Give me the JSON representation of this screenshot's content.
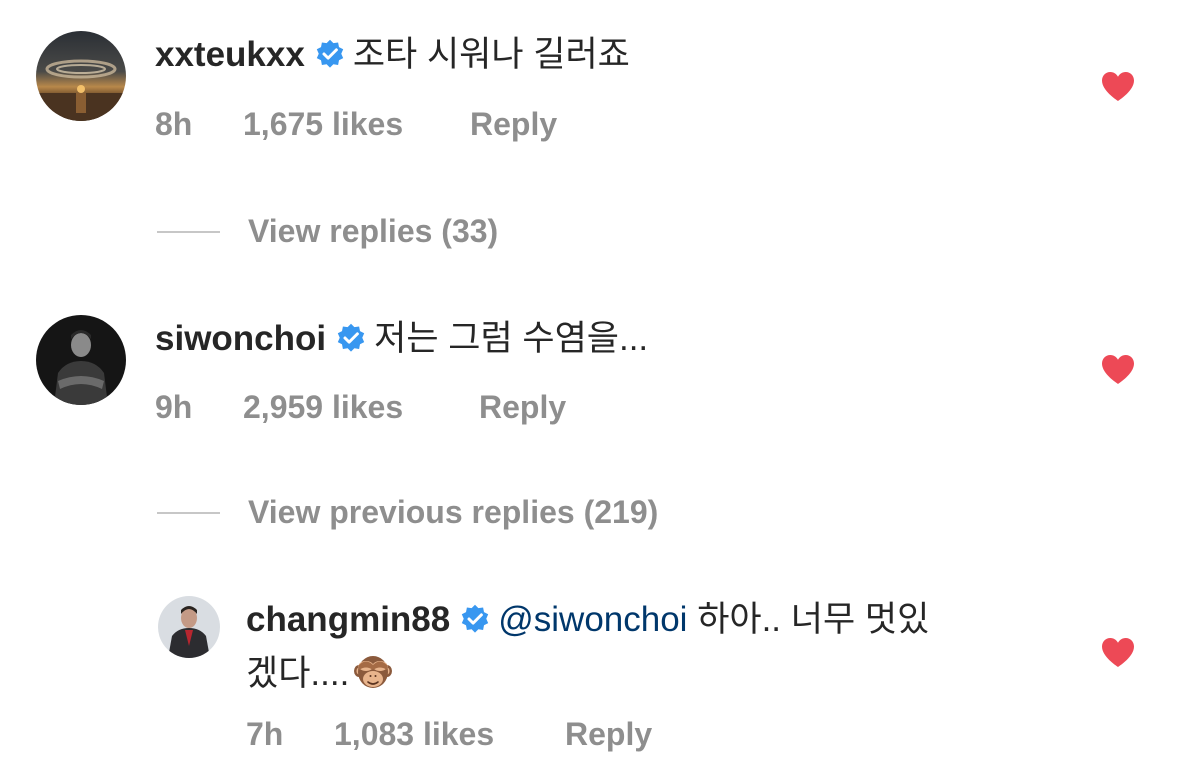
{
  "colors": {
    "heart": "#ed4956",
    "verified": "#3897f0",
    "secondary_text": "#8e8e8e",
    "mention": "#00376b"
  },
  "comments": [
    {
      "username": "xxteukxx",
      "verified": true,
      "text": "조타 시워나 길러죠",
      "time": "8h",
      "likes": "1,675 likes",
      "reply_label": "Reply",
      "liked": true
    },
    {
      "username": "siwonchoi",
      "verified": true,
      "text": "저는 그럼 수염을...",
      "time": "9h",
      "likes": "2,959 likes",
      "reply_label": "Reply",
      "liked": true
    }
  ],
  "view_replies_1": "View replies (33)",
  "view_previous_replies": "View previous replies (219)",
  "reply": {
    "username": "changmin88",
    "verified": true,
    "mention": "@siwonchoi",
    "text_line1": "하아.. 너무 멋있",
    "text_line2": "겠다....",
    "emoji": "see-no-evil-monkey",
    "time": "7h",
    "likes": "1,083 likes",
    "reply_label": "Reply",
    "liked": true
  }
}
